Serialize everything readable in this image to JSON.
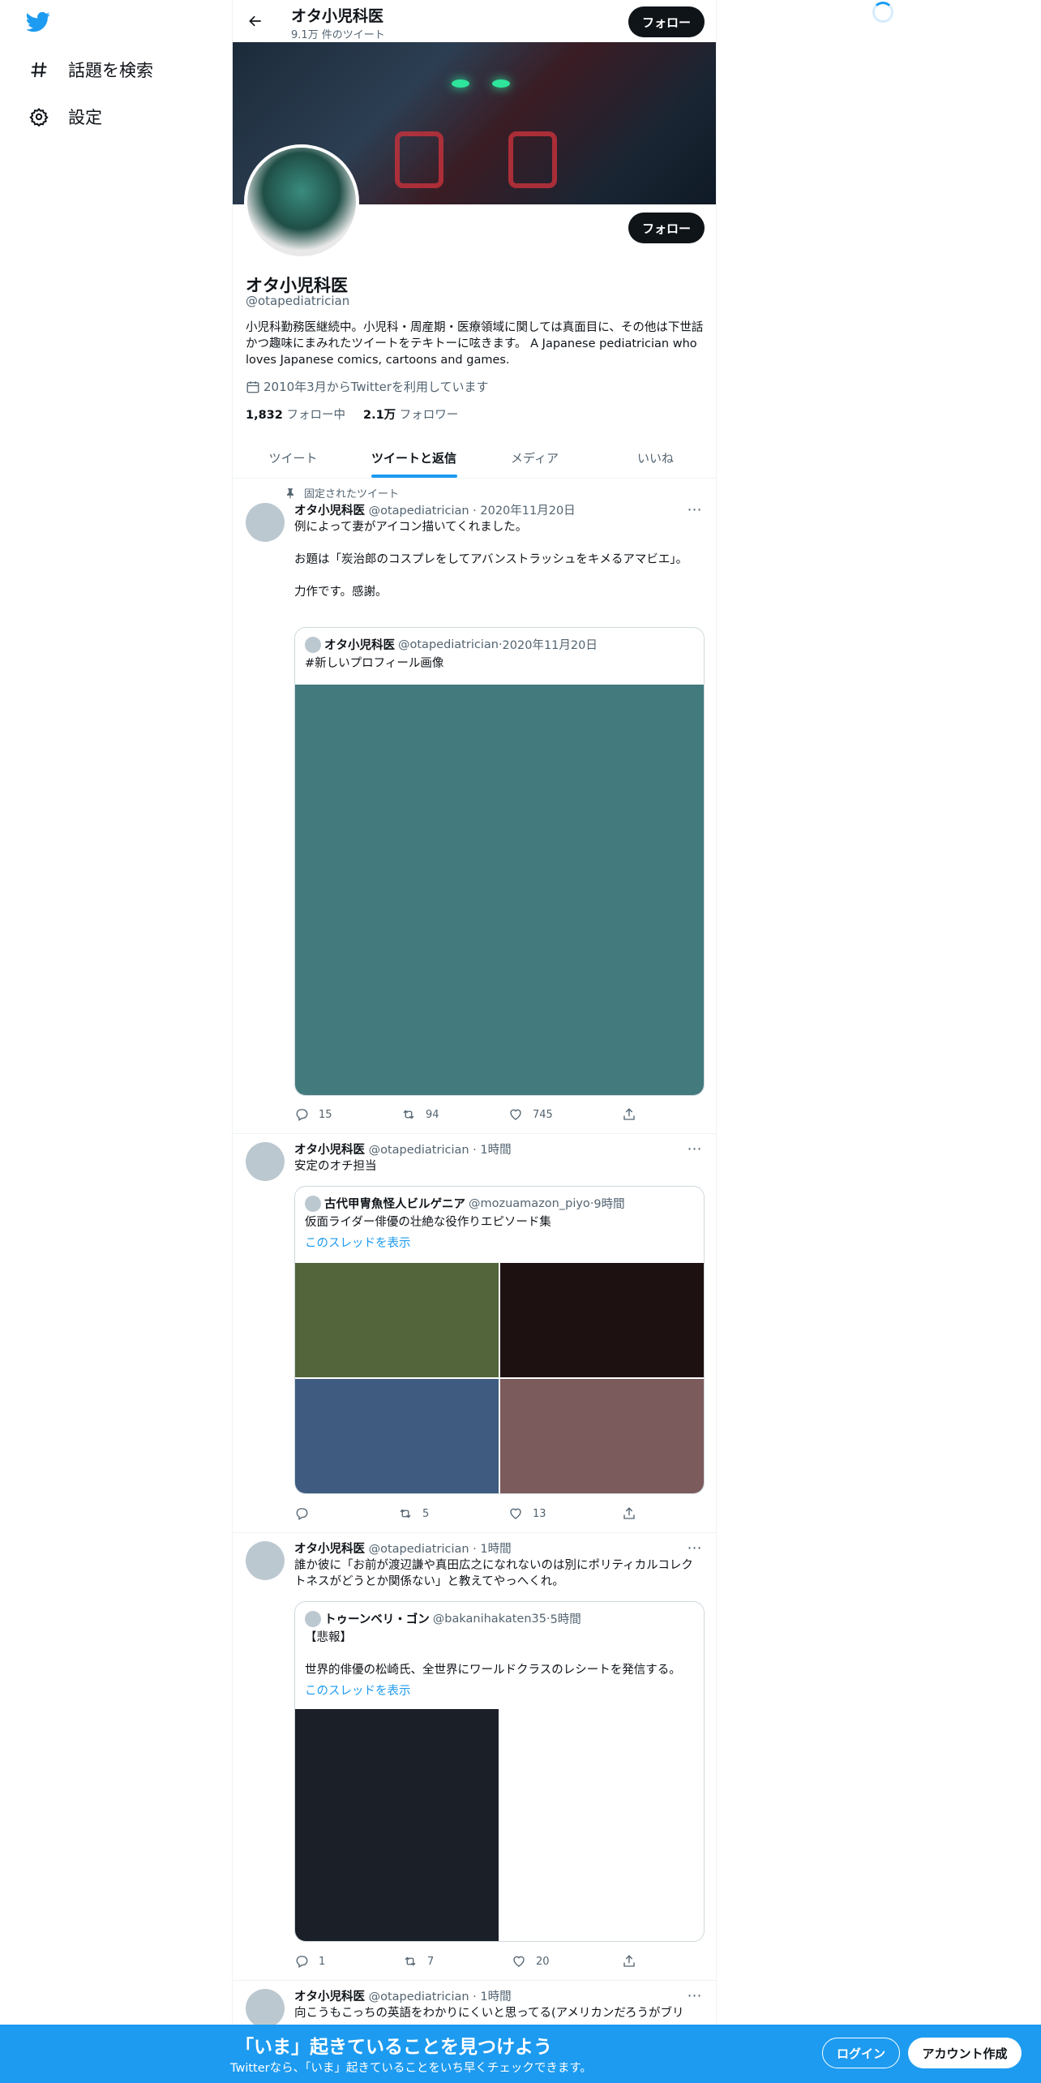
{
  "nav": {
    "explore": "話題を検索",
    "settings": "設定"
  },
  "header": {
    "name": "オタ小児科医",
    "tweet_count": "9.1万 件のツイート",
    "follow": "フォロー"
  },
  "profile": {
    "name": "オタ小児科医",
    "handle": "@otapediatrician",
    "bio": "小児科勤務医継続中。小児科・周産期・医療領域に関しては真面目に、その他は下世話かつ趣味にまみれたツイートをテキトーに呟きます。 A Japanese pediatrician who loves Japanese comics, cartoons and games.",
    "joined": "2010年3月からTwitterを利用しています",
    "following_count": "1,832",
    "following_label": "フォロー中",
    "followers_count": "2.1万",
    "followers_label": "フォロワー",
    "follow": "フォロー"
  },
  "tabs": [
    "ツイート",
    "ツイートと返信",
    "メディア",
    "いいね"
  ],
  "tweets": [
    {
      "pinned_label": "固定されたツイート",
      "name": "オタ小児科医",
      "handle": "@otapediatrician",
      "time": "2020年11月20日",
      "text": "例によって妻がアイコン描いてくれました。\n\nお題は「炭治郎のコスプレをしてアバンストラッシュをキメるアマビエ」。\n\n力作です。感謝。",
      "quote": {
        "name": "オタ小児科医",
        "handle": "@otapediatrician",
        "time": "2020年11月20日",
        "text": "#新しいプロフィール画像"
      },
      "media_colors": [
        "#437a7e"
      ],
      "replies": "15",
      "retweets": "94",
      "likes": "745"
    },
    {
      "name": "オタ小児科医",
      "handle": "@otapediatrician",
      "time": "1時間",
      "text": "安定のオチ担当",
      "quote": {
        "name": "古代甲冑魚怪人ビルゲニア",
        "handle": "@mozuamazon_piyo",
        "time": "9時間",
        "text": "仮面ライダー俳優の壮絶な役作りエピソード集",
        "link": "このスレッドを表示"
      },
      "media_colors": [
        "#53663b",
        "#1d1111",
        "#3f5c80",
        "#7c5b5d"
      ],
      "replies": "",
      "retweets": "5",
      "likes": "13"
    },
    {
      "name": "オタ小児科医",
      "handle": "@otapediatrician",
      "time": "1時間",
      "text": "誰か彼に「お前が渡辺謙や真田広之になれないのは別にポリティカルコレクトネスがどうとか関係ない」と教えてやっへくれ。",
      "quote": {
        "name": "トゥーンベリ・ゴン",
        "handle": "@bakanihakaten35",
        "time": "5時間",
        "text": "【悲報】\n\n世界的俳優の松崎氏、全世界にワールドクラスのレシートを発信する。",
        "link": "このスレッドを表示"
      },
      "media_colors": [
        "#1a1f28"
      ],
      "replies": "1",
      "retweets": "7",
      "likes": "20"
    },
    {
      "name": "オタ小児科医",
      "handle": "@otapediatrician",
      "time": "1時間",
      "text": "向こうもこっちの英語をわかりにくいと思ってる(アメリカンだろうがブリ"
    }
  ],
  "bottom_bar": {
    "title": "「いま」起きていることを見つけよう",
    "subtitle": "Twitterなら、「いま」起きていることをいち早くチェックできます。",
    "login": "ログイン",
    "signup": "アカウント作成"
  },
  "icons": {
    "logo": "twitter-bird-icon",
    "explore": "hashtag-icon",
    "settings": "gear-icon",
    "back": "arrow-left-icon",
    "reply": "reply-icon",
    "retweet": "retweet-icon",
    "like": "heart-icon",
    "share": "share-icon"
  },
  "colors": {
    "accent": "#1d9bf0",
    "text": "#0f1419",
    "muted": "#536471"
  }
}
